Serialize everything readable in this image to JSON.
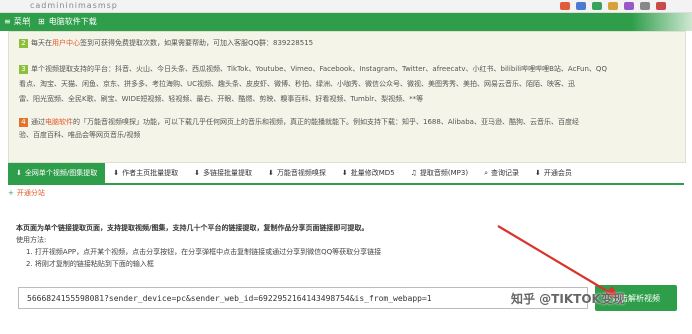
{
  "browser": {
    "url_fragment": "cadmininimasmsp"
  },
  "nav": {
    "menu_label": "菜单",
    "site_label": "电脑软件下载"
  },
  "info": {
    "line1_num": "2",
    "line1_pre": "每天在",
    "line1_link": "用户中心",
    "line1_post": "签到可获得免费提取次数，如果需要帮助，可加入客服QQ群：839228515",
    "line2_num": "3",
    "line2_a": "单个视频提取支持的平台：抖音、火山、今日头条、西瓜视频、TikTok、Youtube、Vimeo、Facebook、Instagram、Twitter、afreecatv、小红书、bilibili哔哩哔哩B站、AcFun、QQ",
    "line2_b": "看点、淘宝、天猫、闲鱼、京东、拼多多、考拉海购、UC视频、趣头条、皮皮虾、微博、秒拍、绿洲、小咖秀、微信公众号、微视、美图秀秀、美拍、网易云音乐、陌陌、映客、迅",
    "line2_c": "雷、阳光宽频、全民K歌、刷宝、WIDE短视频、轻视频、最右、开眼、酷燃、剪映、糗事百科、好看视频、Tumblr、梨视频、**等",
    "line3_num": "4",
    "line3_pre": "通过",
    "line3_link": "电脑软件",
    "line3_a": "的「万能音视频嗅探」功能，可以下载几乎任何网页上的音乐和视频，真正的能播就能下。例如支持下载：知乎、1688、Alibaba、亚马逊、酷狗、云音乐、百度经",
    "line3_b": "验、百度百科、唯品会等网页音乐/视频"
  },
  "tabs": [
    {
      "label": "全网单个视频/图集提取",
      "icon": "download-icon"
    },
    {
      "label": "作者主页批量提取",
      "icon": "download-icon"
    },
    {
      "label": "多链接批量提取",
      "icon": "download-icon"
    },
    {
      "label": "万能音视频嗅探",
      "icon": "download-icon"
    },
    {
      "label": "批量修改MD5",
      "icon": "download-icon"
    },
    {
      "label": "提取音频(MP3)",
      "icon": "music-icon"
    },
    {
      "label": "查询记录",
      "icon": "search-icon"
    },
    {
      "label": "开通会员",
      "icon": "download-icon"
    }
  ],
  "tab_row2": {
    "label": "开通分站",
    "icon": "plus-icon"
  },
  "instructions": {
    "intro": "本页面为单个链接提取页面，支持提取视频/图集，支持几十个平台的链接提取，复制作品分享页面链接即可提取。",
    "usage_title": "使用方法:",
    "step1": "1. 打开视频APP，点开某个视频，点击分享按钮，在分享弹框中点击复制链接或通过分享到微信QQ等获取分享链接",
    "step2": "2. 将刚才复制的链接粘贴到下面的输入框"
  },
  "url_input": {
    "value": "5666824155598081?sender_device=pc&sender_web_id=6922952164143498754&is_from_webapp=1"
  },
  "parse_button": {
    "label": "点击解析视频"
  },
  "watermark": "知乎 @TIKTOK变现",
  "colors": {
    "brand_green": "#2f9e4b",
    "accent_orange": "#e3722b",
    "annotation_red": "#d9342b"
  }
}
